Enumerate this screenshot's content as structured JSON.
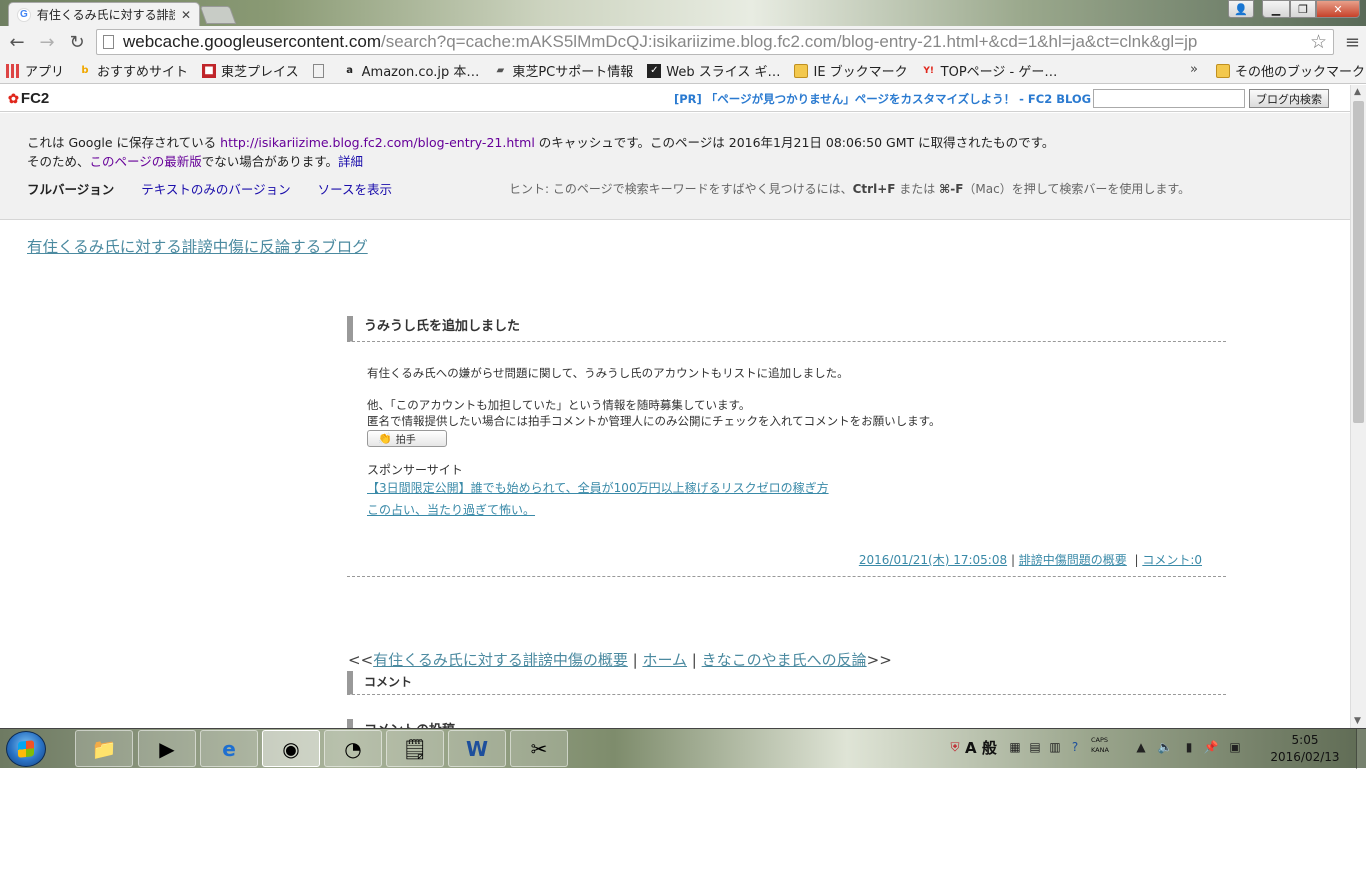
{
  "browser": {
    "tab_title": "有住くるみ氏に対する誹謗",
    "tab_favicon": "G",
    "url_host": "webcache.googleusercontent.com",
    "url_path": "/search?q=cache:mAKS5lMmDcQJ:isikariizime.blog.fc2.com/blog-entry-21.html+&cd=1&hl=ja&ct=clnk&gl=jp"
  },
  "bookmarks": {
    "items": [
      {
        "label": "アプリ",
        "icon": "apps-icon"
      },
      {
        "label": "おすすめサイト",
        "icon": "bing-icon"
      },
      {
        "label": "東芝プレイス",
        "icon": "toshiba-icon"
      },
      {
        "label": "",
        "icon": "page-icon"
      },
      {
        "label": "Amazon.co.jp 本…",
        "icon": "amazon-icon"
      },
      {
        "label": "東芝PCサポート情報",
        "icon": "toshiba-support-icon"
      },
      {
        "label": "Web スライス ギ…",
        "icon": "web-slice-icon"
      },
      {
        "label": "IE ブックマーク",
        "icon": "folder-icon"
      },
      {
        "label": "TOPページ - ゲー…",
        "icon": "yahoo-icon"
      }
    ],
    "more": "»",
    "other": "その他のブックマーク"
  },
  "fc2": {
    "logo": "FC2",
    "pr_text": "[PR] 「ページが見つかりません」ページをカスタマイズしよう！ - FC2 BLOG Pro",
    "search_button": "ブログ内検索"
  },
  "cache": {
    "line1_prefix": "これは Google に保存されている ",
    "line1_url": "http://isikariizime.blog.fc2.com/blog-entry-21.html",
    "line1_suffix": " のキャッシュです。このページは 2016年1月21日 08:06:50 GMT に取得されたものです。",
    "line2_prefix": "そのため、",
    "line2_link": "このページの最新版",
    "line2_suffix": "でない場合があります。",
    "line2_details": "詳細",
    "tab_full": "フルバージョン",
    "tab_text": "テキストのみのバージョン",
    "tab_source": "ソースを表示",
    "hint_prefix": "ヒント: このページで検索キーワードをすばやく見つけるには、",
    "hint_key1": "Ctrl+F",
    "hint_mid": " または ",
    "hint_key2": "⌘-F",
    "hint_suffix": "（Mac）を押して検索バーを使用します。"
  },
  "blog": {
    "title": "有住くるみ氏に対する誹謗中傷に反論するブログ",
    "entry_title": "うみうし氏を追加しました",
    "body_line1": "有住くるみ氏への嫌がらせ問題に関して、うみうし氏のアカウントもリストに追加しました。",
    "body_line2": "他、「このアカウントも加担していた」という情報を随時募集しています。",
    "body_line3": "匿名で情報提供したい場合には拍手コメントか管理人にのみ公開にチェックを入れてコメントをお願いします。",
    "clap_label": "拍手",
    "sponsor_label": "スポンサーサイト",
    "sponsor_link1": "【3日間限定公開】誰でも始められて、全員が100万円以上稼げるリスクゼロの稼ぎ方",
    "sponsor_link2": "この占い、当たり過ぎて怖い。",
    "footer_date": "2016/01/21(木) 17:05:08",
    "footer_category": "誹謗中傷問題の概要",
    "footer_comment": "コメント:0",
    "pager_prev": "有住くるみ氏に対する誹謗中傷の概要",
    "pager_home": "ホーム",
    "pager_next": "きなこのやま氏への反論",
    "comment_heading": "コメント",
    "cut_heading": "コメントの投稿"
  },
  "taskbar": {
    "ime_label": "A 般",
    "caps": "CAPS",
    "kana": "KANA",
    "time": "5:05",
    "date": "2016/02/13"
  }
}
